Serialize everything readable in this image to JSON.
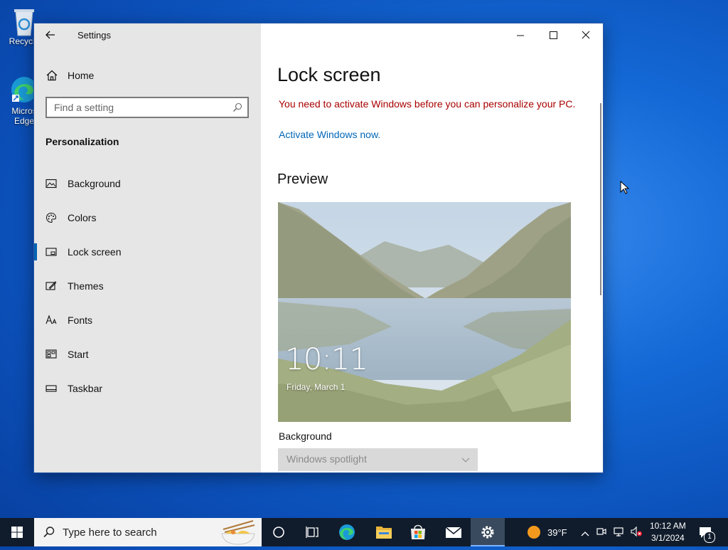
{
  "desktop": {
    "recycle_bin_label": "Recycle",
    "edge_label_line1": "Micros",
    "edge_label_line2": "Edge"
  },
  "window": {
    "app_title": "Settings",
    "home_label": "Home",
    "search_placeholder": "Find a setting",
    "section_title": "Personalization",
    "nav_items": [
      {
        "label": "Background",
        "icon": "picture-icon"
      },
      {
        "label": "Colors",
        "icon": "palette-icon"
      },
      {
        "label": "Lock screen",
        "icon": "lock-screen-icon",
        "active": true
      },
      {
        "label": "Themes",
        "icon": "themes-icon"
      },
      {
        "label": "Fonts",
        "icon": "fonts-icon"
      },
      {
        "label": "Start",
        "icon": "start-icon"
      },
      {
        "label": "Taskbar",
        "icon": "taskbar-icon"
      }
    ],
    "controls": [
      "minimize",
      "maximize",
      "close"
    ]
  },
  "content": {
    "page_title": "Lock screen",
    "warning": "You need to activate Windows before you can personalize your PC.",
    "activate_link": "Activate Windows now.",
    "preview_title": "Preview",
    "preview_time": "10:11",
    "preview_date": "Friday, March 1",
    "background_label": "Background",
    "background_value": "Windows spotlight"
  },
  "taskbar": {
    "search_label": "Type here to search",
    "weather_temp": "39°F",
    "time": "10:12 AM",
    "date": "3/1/2024",
    "notification_count": "1"
  },
  "colors": {
    "accent": "#0063b1",
    "warning": "#a80000",
    "link": "#0067b8",
    "taskbar": "#101c2c"
  }
}
